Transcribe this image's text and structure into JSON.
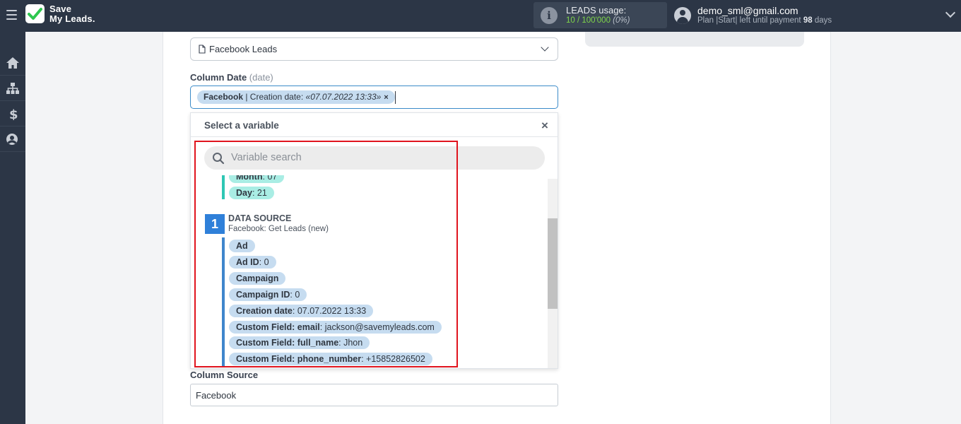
{
  "topbar": {
    "logo_line1": "Save",
    "logo_line2": "My Leads.",
    "usage_title": "LEADS usage:",
    "usage_used": "10",
    "usage_total": "/ 100'000",
    "usage_pct": "(0%)",
    "user_email": "demo_sml@gmail.com",
    "plan_prefix": "Plan |Start| left until payment",
    "plan_days": "98",
    "plan_suffix": "days"
  },
  "sidebar": {
    "items": [
      {
        "icon": "home-icon"
      },
      {
        "icon": "sitemap-icon"
      },
      {
        "icon": "dollar-icon"
      },
      {
        "icon": "user-icon"
      }
    ]
  },
  "form": {
    "selected_source": "Facebook Leads",
    "column_date_label": "Column Date",
    "column_date_hint": "(date)",
    "date_chip": {
      "source": "Facebook",
      "field": " | Creation date: ",
      "value": "«07.07.2022 13:33»",
      "close": "×"
    },
    "column_source_label": "Column Source",
    "column_source_value": "Facebook"
  },
  "dropdown": {
    "title": "Select a variable",
    "close": "×",
    "search_placeholder": "Variable search",
    "partial_items": [
      {
        "key": "Month",
        "value": "07"
      },
      {
        "key": "Day",
        "value": "21"
      }
    ],
    "source_number": "1",
    "source_title": "DATA SOURCE",
    "source_subtitle": "Facebook: Get Leads (new)",
    "items": [
      {
        "key": "Ad",
        "value": ""
      },
      {
        "key": "Ad ID",
        "value": "0"
      },
      {
        "key": "Campaign",
        "value": ""
      },
      {
        "key": "Campaign ID",
        "value": "0"
      },
      {
        "key": "Creation date",
        "value": "07.07.2022 13:33"
      },
      {
        "key": "Custom Field: email",
        "value": "jackson@savemyleads.com"
      },
      {
        "key": "Custom Field: full_name",
        "value": "Jhon"
      },
      {
        "key": "Custom Field: phone_number",
        "value": "+15852826502"
      }
    ]
  },
  "colors": {
    "topbar_bg": "#2c3646",
    "accent_blue": "#3b8bc9",
    "highlight_red": "#e0141e",
    "pill_blue": "#c6dcf0",
    "pill_teal": "#a9ede4"
  }
}
